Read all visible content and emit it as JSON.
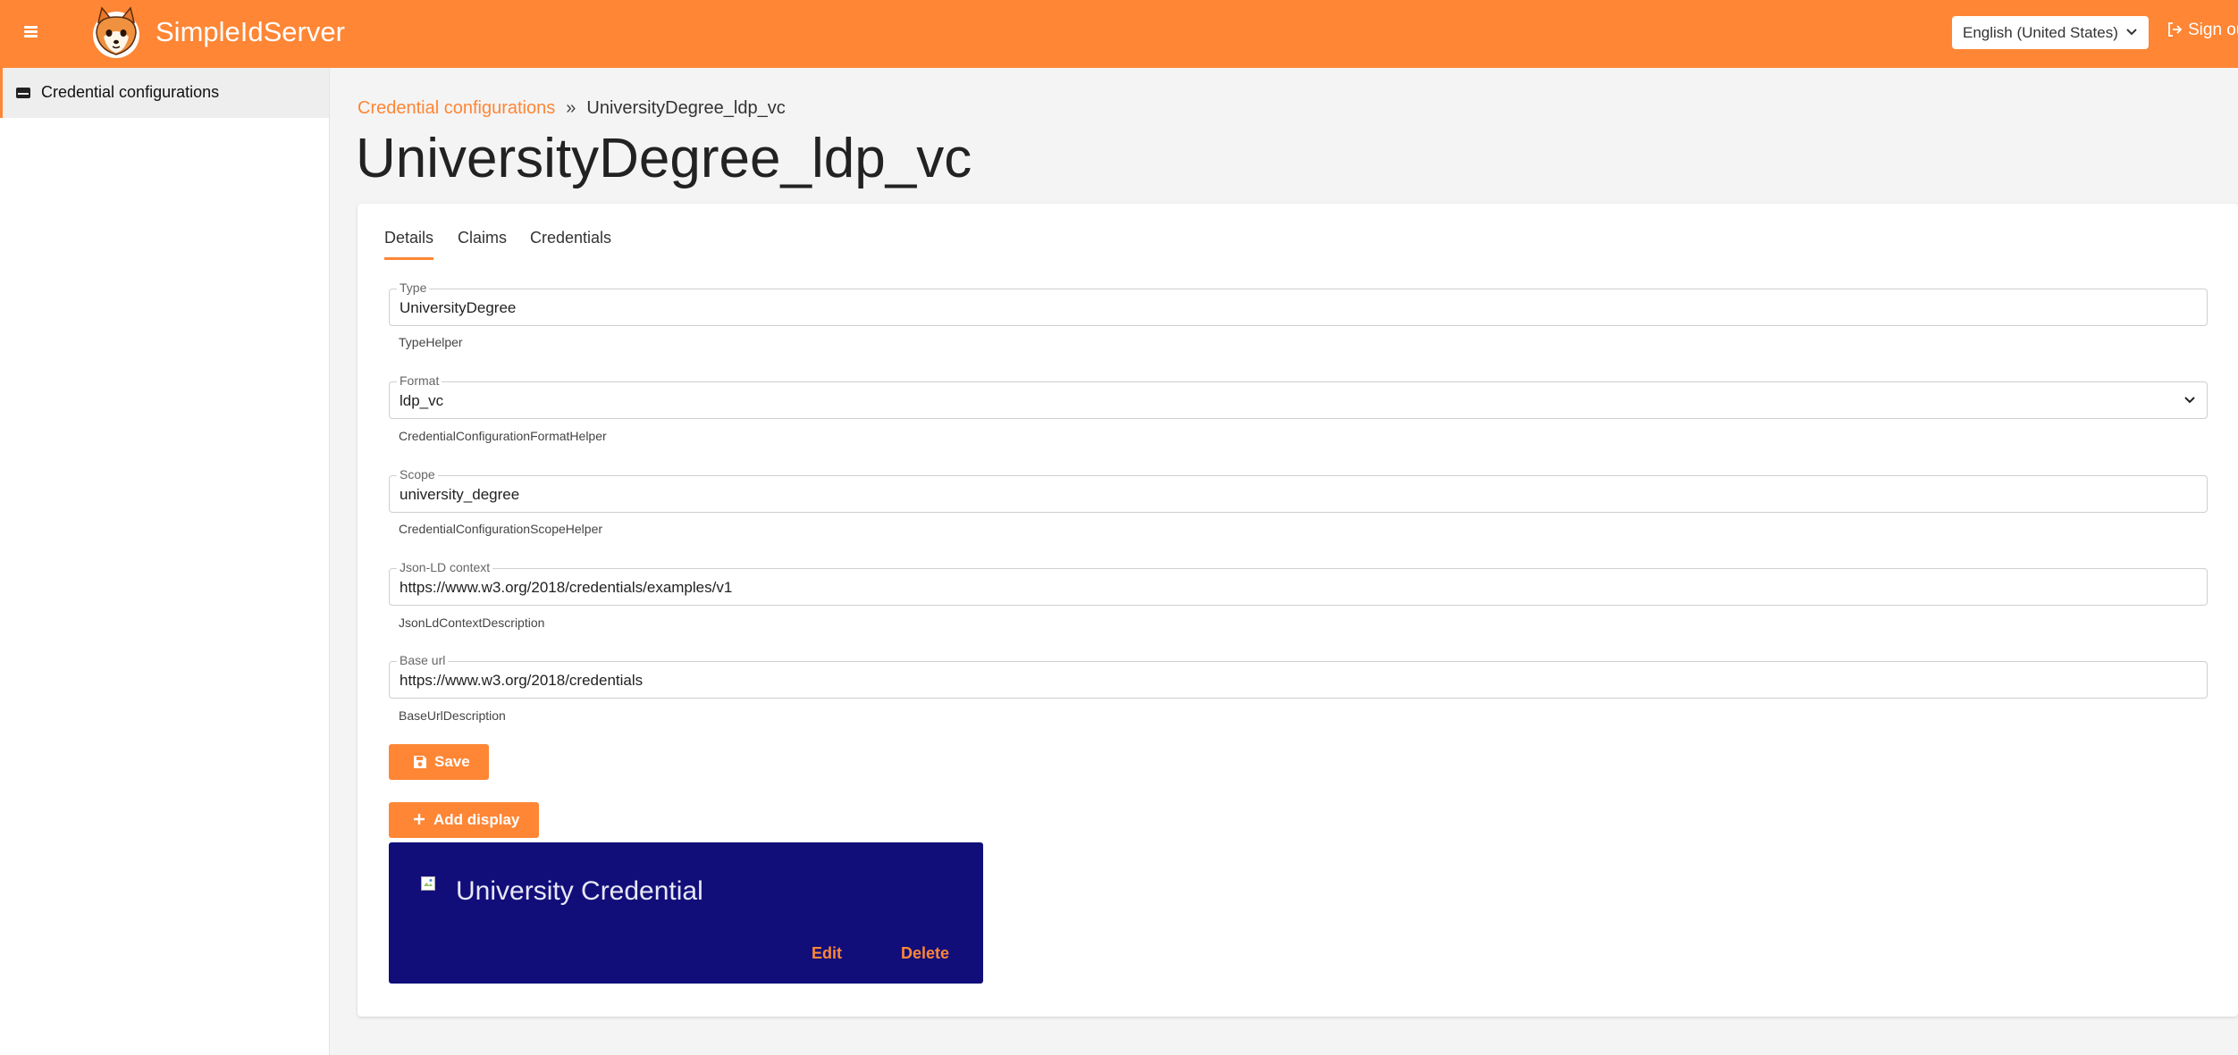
{
  "header": {
    "brand": "SimpleIdServer",
    "language": "English (United States)",
    "sign_out": "Sign out"
  },
  "sidebar": {
    "items": [
      {
        "label": "Credential configurations"
      }
    ]
  },
  "breadcrumb": {
    "parent": "Credential configurations",
    "separator": "»",
    "current": "UniversityDegree_ldp_vc"
  },
  "page": {
    "title": "UniversityDegree_ldp_vc"
  },
  "tabs": [
    {
      "label": "Details",
      "active": true
    },
    {
      "label": "Claims",
      "active": false
    },
    {
      "label": "Credentials",
      "active": false
    }
  ],
  "form": {
    "type": {
      "label": "Type",
      "value": "UniversityDegree",
      "helper": "TypeHelper"
    },
    "format": {
      "label": "Format",
      "value": "ldp_vc",
      "helper": "CredentialConfigurationFormatHelper"
    },
    "scope": {
      "label": "Scope",
      "value": "university_degree",
      "helper": "CredentialConfigurationScopeHelper"
    },
    "json_ld_context": {
      "label": "Json-LD context",
      "value": "https://www.w3.org/2018/credentials/examples/v1",
      "helper": "JsonLdContextDescription"
    },
    "base_url": {
      "label": "Base url",
      "value": "https://www.w3.org/2018/credentials",
      "helper": "BaseUrlDescription"
    }
  },
  "buttons": {
    "save": "Save",
    "add_display": "Add display"
  },
  "display": {
    "title": "University Credential",
    "edit": "Edit",
    "delete": "Delete",
    "background_color": "#110e7a"
  },
  "colors": {
    "accent": "#fe8635",
    "background": "#f4f4f4"
  }
}
